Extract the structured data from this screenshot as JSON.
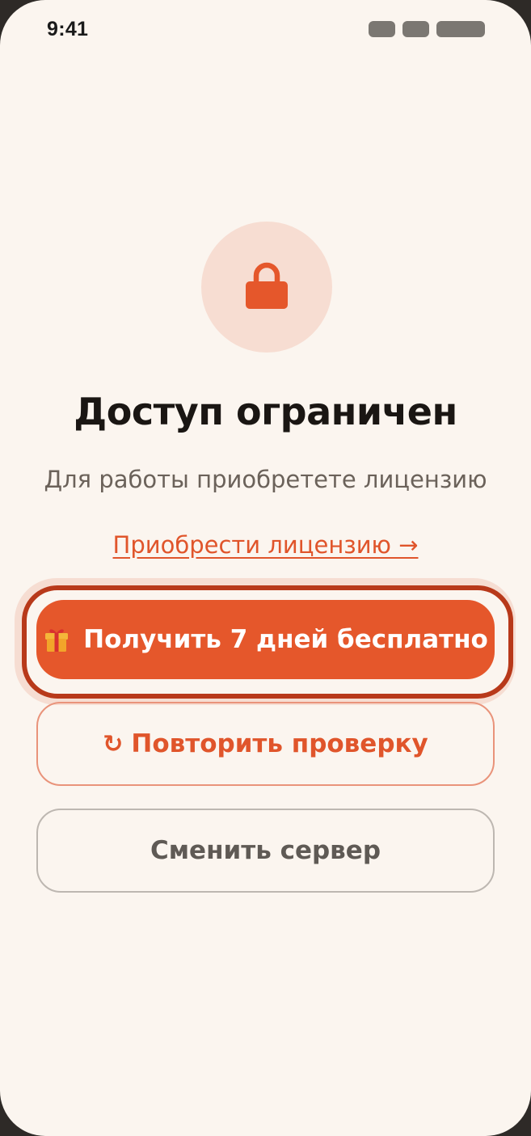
{
  "status_bar": {
    "time": "9:41",
    "icons": [
      "signal-icon",
      "wifi-icon",
      "battery-icon"
    ]
  },
  "lock": {
    "icon": "lock-icon"
  },
  "title": "Доступ ограничен",
  "subtitle": "Для работы приобретете лицензию",
  "buy_link": "Приобрести лицензию →",
  "trial_button": {
    "icon": "gift-icon",
    "label": "Получить 7 дней бесплатно"
  },
  "retry_button": {
    "icon": "↻",
    "label": "Повторить проверку"
  },
  "server_button": {
    "label": "Сменить сервер"
  },
  "colors": {
    "accent": "#e5572b",
    "background": "#fbf5ef",
    "lock_circle": "#f7ddd2",
    "focus_ring": "#b8391a"
  }
}
